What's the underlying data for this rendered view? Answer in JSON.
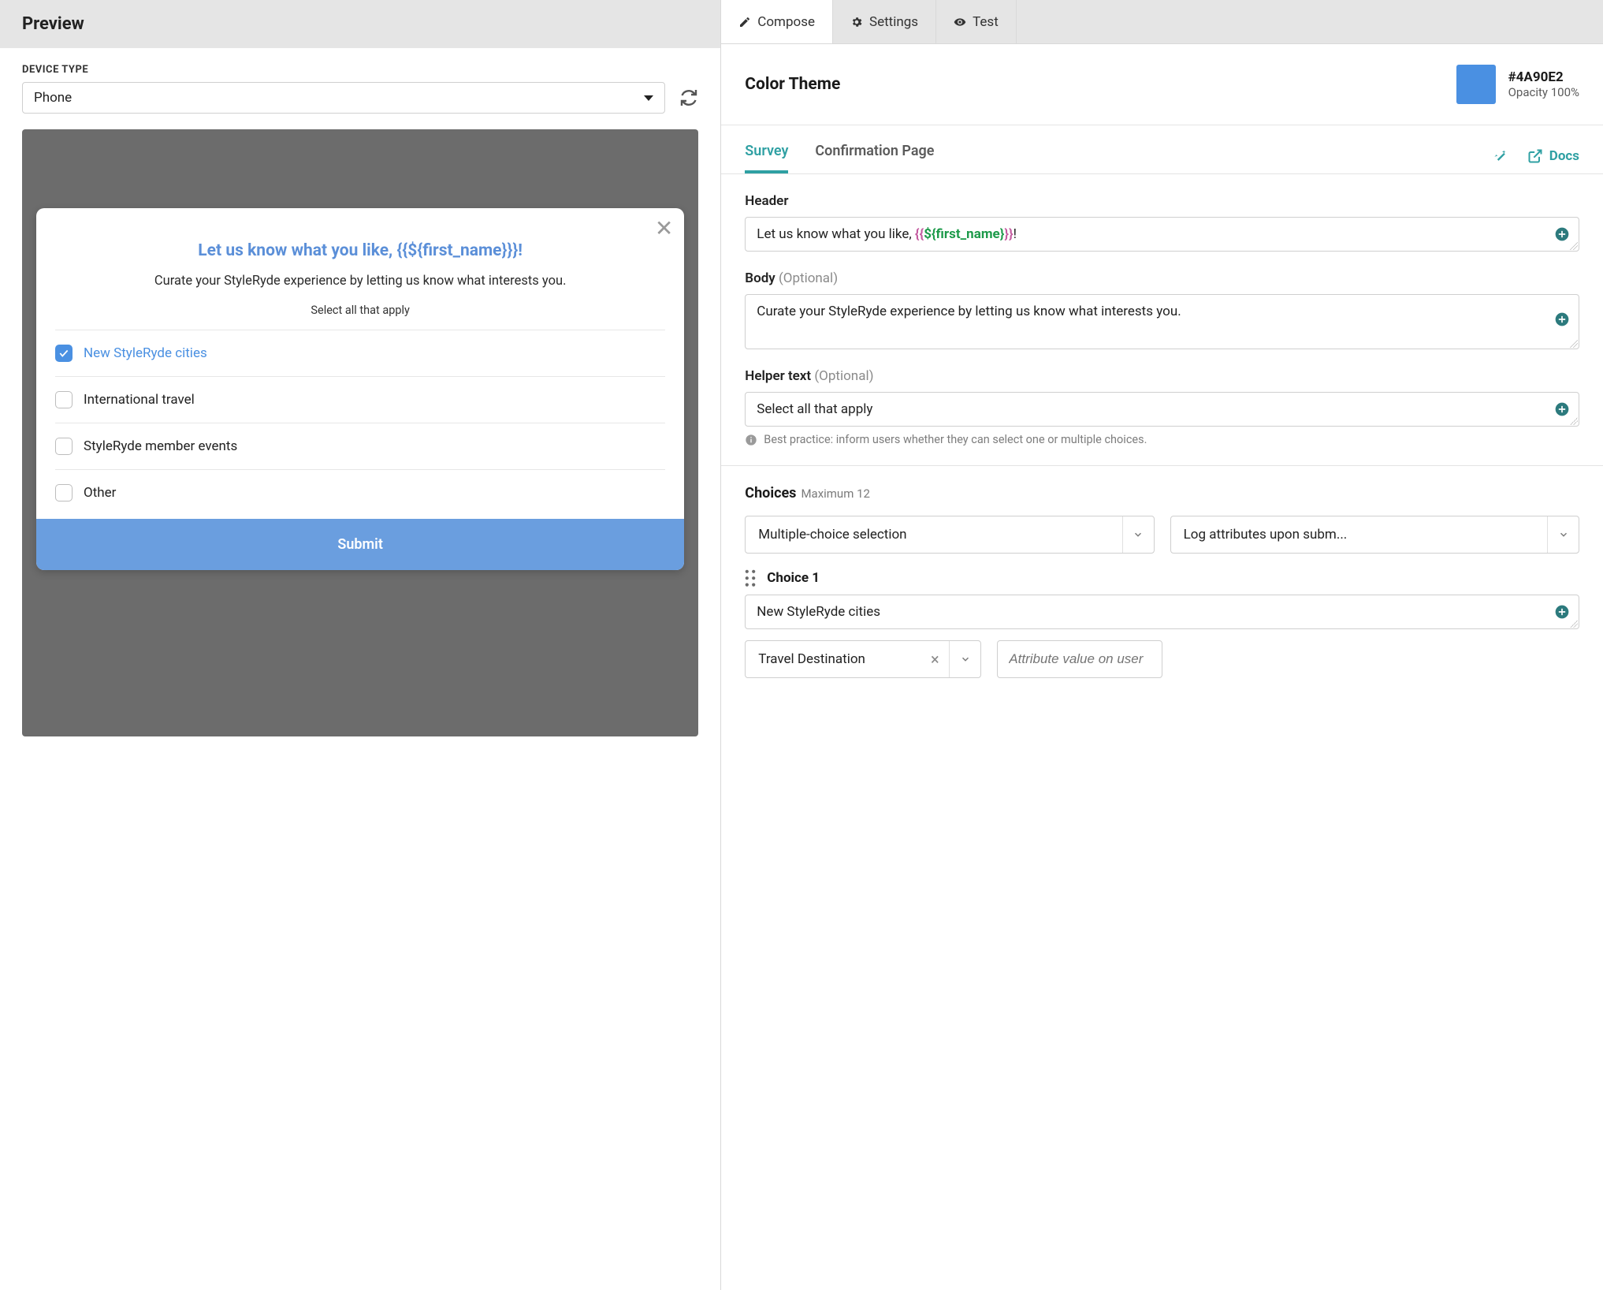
{
  "preview": {
    "title": "Preview",
    "device_type_label": "DEVICE TYPE",
    "device_type_value": "Phone",
    "survey": {
      "title_prefix": "Let us know what you like, ",
      "title_token_open": "{{${",
      "title_token_var": "first_name",
      "title_token_close": "}}}",
      "title_suffix": "!",
      "body": "Curate your StyleRyde experience by letting us know what interests you.",
      "helper": "Select all that apply",
      "choices": [
        {
          "label": "New StyleRyde cities",
          "checked": true
        },
        {
          "label": "International travel",
          "checked": false
        },
        {
          "label": "StyleRyde member events",
          "checked": false
        },
        {
          "label": "Other",
          "checked": false
        }
      ],
      "submit": "Submit"
    }
  },
  "editor": {
    "tabs": {
      "compose": "Compose",
      "settings": "Settings",
      "test": "Test"
    },
    "theme": {
      "title": "Color Theme",
      "hex": "#4A90E2",
      "opacity": "Opacity 100%"
    },
    "subtabs": {
      "survey": "Survey",
      "confirmation": "Confirmation Page",
      "docs": "Docs"
    },
    "fields": {
      "header_label": "Header",
      "header_prefix": "Let us know what you like, ",
      "header_token_open": "{{",
      "header_token_dollar_open": "${",
      "header_token_var": "first_name",
      "header_token_dollar_close": "}",
      "header_token_close": "}}",
      "header_suffix": "!",
      "body_label": "Body",
      "optional": "(Optional)",
      "body_value": "Curate your StyleRyde experience by letting us know what interests you.",
      "helper_label": "Helper text",
      "helper_value": "Select all that apply",
      "helper_hint": "Best practice: inform users whether they can select one or multiple choices."
    },
    "choices_section": {
      "title": "Choices",
      "max": "Maximum 12",
      "selection_type": "Multiple-choice selection",
      "log_attrs": "Log attributes upon subm...",
      "choice1_label": "Choice 1",
      "choice1_value": "New StyleRyde cities",
      "choice1_attr": "Travel Destination",
      "attr_value_placeholder": "Attribute value on user"
    }
  }
}
